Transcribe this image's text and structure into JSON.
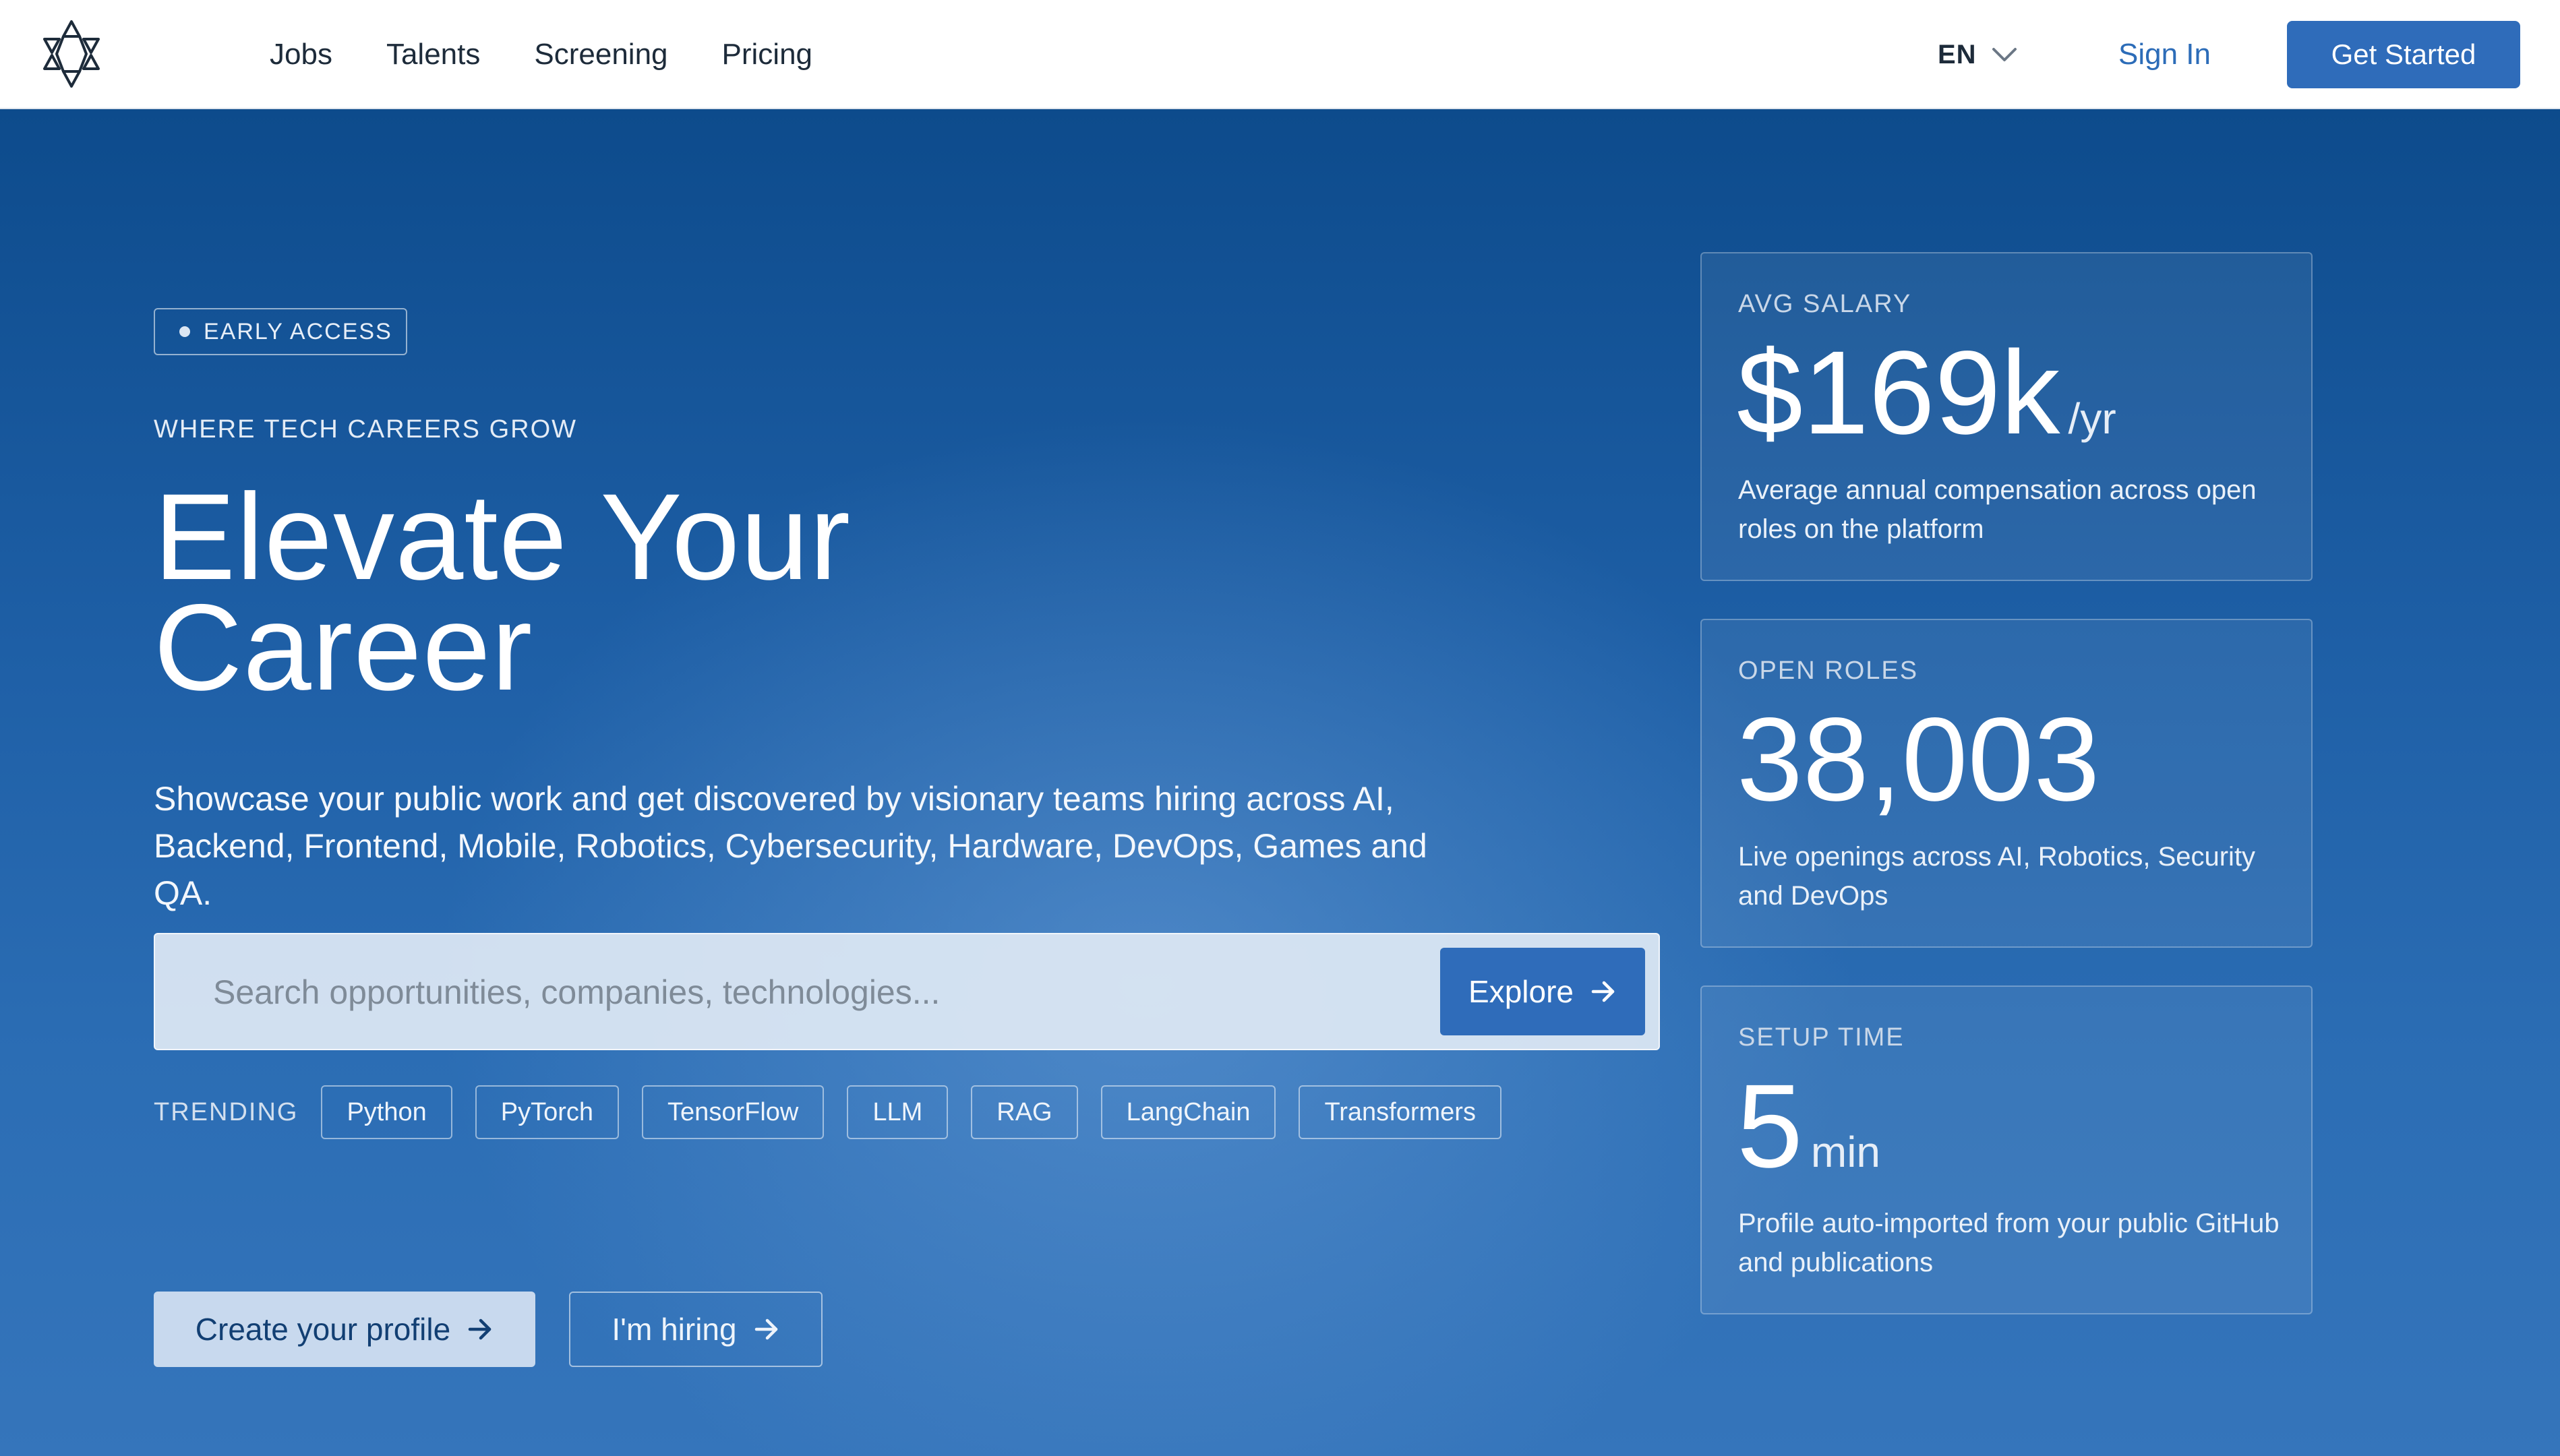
{
  "header": {
    "nav": [
      "Jobs",
      "Talents",
      "Screening",
      "Pricing"
    ],
    "language": "EN",
    "sign_in": "Sign In",
    "get_started": "Get Started"
  },
  "hero": {
    "badge": "EARLY ACCESS",
    "kicker": "WHERE TECH CAREERS GROW",
    "headline": [
      "Elevate Your",
      "Career"
    ],
    "subtitle": "Showcase your public work and get discovered by visionary teams hiring across AI, Backend, Frontend, Mobile, Robotics, Cybersecurity, Hardware, DevOps, Games and QA.",
    "search": {
      "placeholder": "Search opportunities, companies, technologies...",
      "value": "",
      "button": "Explore"
    },
    "trending": {
      "label": "TRENDING",
      "tags": [
        "Python",
        "PyTorch",
        "TensorFlow",
        "LLM",
        "RAG",
        "LangChain",
        "Transformers"
      ]
    },
    "actions": {
      "primary": "Create your profile",
      "secondary": "I'm hiring"
    }
  },
  "stats": [
    {
      "label": "AVG SALARY",
      "value": "$169k",
      "unit": "/yr",
      "description": "Average annual compensation across open roles on the platform"
    },
    {
      "label": "OPEN ROLES",
      "value": "38,003",
      "unit": "",
      "description": "Live openings across AI, Robotics, Security and DevOps"
    },
    {
      "label": "SETUP TIME",
      "value": "5",
      "unit": "min",
      "description": "Profile auto-imported from your public GitHub and publications"
    }
  ],
  "icons": {
    "logo": "star-of-triangles-logo",
    "language_toggle": "chevron-down-icon",
    "buttons": "arrow-right-icon"
  },
  "colors": {
    "brand_blue": "#2f6cba",
    "hero_top": "#0d4b8c",
    "hero_bottom": "#3575bb",
    "link_blue": "#2c6cb8"
  }
}
